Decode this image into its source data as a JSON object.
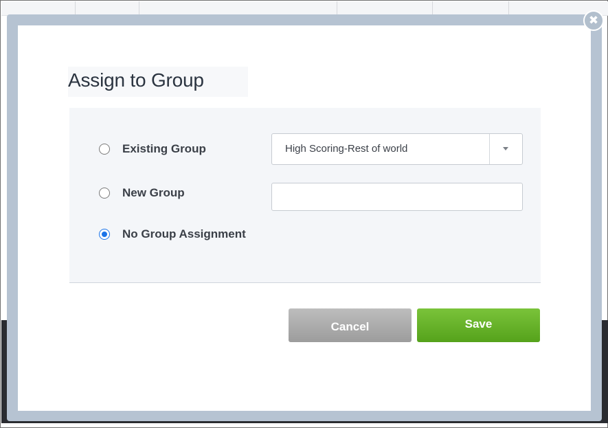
{
  "dialog": {
    "title": "Assign to Group",
    "close_icon": "close-icon"
  },
  "options": [
    {
      "label": "Existing Group",
      "checked": false
    },
    {
      "label": "New Group",
      "checked": false
    },
    {
      "label": "No Group Assignment",
      "checked": true
    }
  ],
  "existing_group_select": {
    "value": "High Scoring-Rest of world",
    "icon": "chevron-down-icon"
  },
  "new_group_input": {
    "value": "",
    "placeholder": ""
  },
  "buttons": {
    "cancel_label": "Cancel",
    "save_label": "Save"
  },
  "colors": {
    "save_green": "#6cb52f",
    "cancel_gray": "#ababab",
    "radio_blue": "#1a73e8",
    "modal_frame": "#b6c3d2"
  }
}
